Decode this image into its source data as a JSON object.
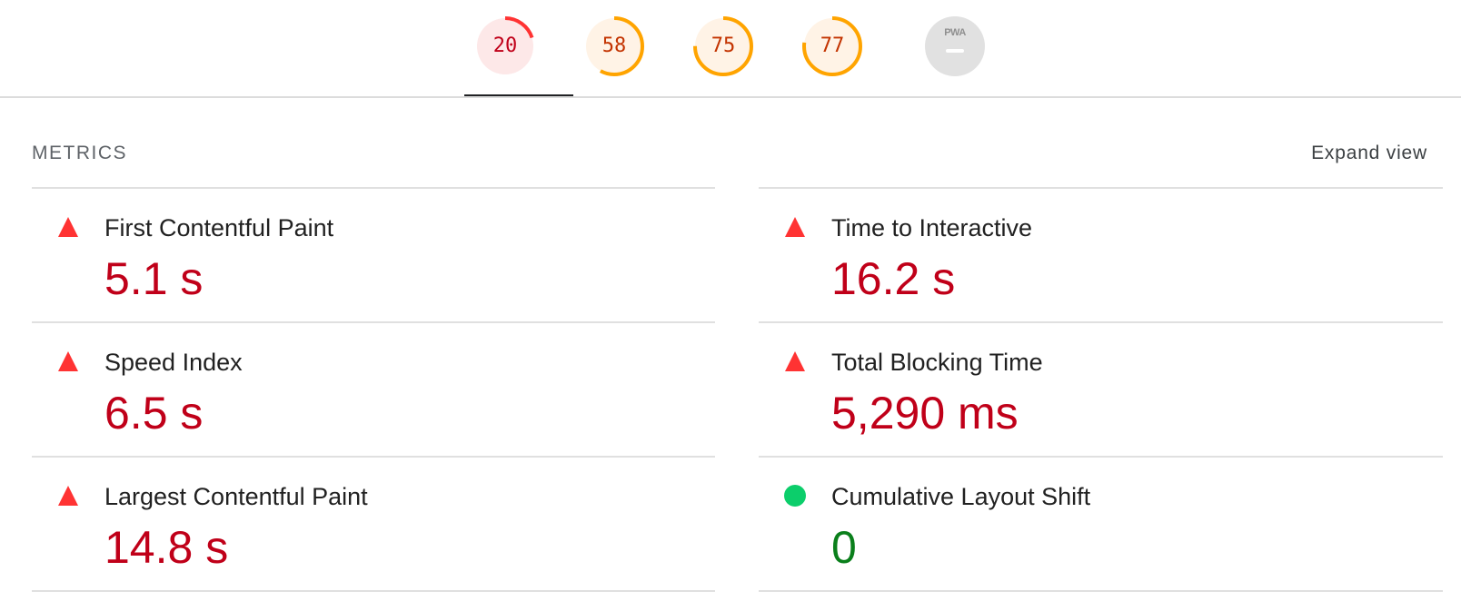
{
  "categories": [
    {
      "score": "20",
      "status": "fail",
      "progress": 0.2,
      "ring_color": "#ff3333",
      "bg_color": "#fde8e8",
      "text_color": "#c00019",
      "icon": "score-gauge"
    },
    {
      "score": "58",
      "status": "average",
      "progress": 0.58,
      "ring_color": "#ffa400",
      "bg_color": "#fff3e6",
      "text_color": "#c33300",
      "icon": "score-gauge"
    },
    {
      "score": "75",
      "status": "average",
      "progress": 0.75,
      "ring_color": "#ffa400",
      "bg_color": "#fff3e6",
      "text_color": "#c33300",
      "icon": "score-gauge"
    },
    {
      "score": "77",
      "status": "average",
      "progress": 0.77,
      "ring_color": "#ffa400",
      "bg_color": "#fff3e6",
      "text_color": "#c33300",
      "icon": "score-gauge"
    },
    {
      "label": "PWA",
      "status": "not-applicable",
      "bg_color": "#e1e1e1",
      "icon": "pwa-badge"
    }
  ],
  "metrics_section": {
    "title": "METRICS",
    "expand_label": "Expand view"
  },
  "metrics_left": [
    {
      "label": "First Contentful Paint",
      "value": "5.1 s",
      "status": "fail",
      "icon": "red-triangle"
    },
    {
      "label": "Speed Index",
      "value": "6.5 s",
      "status": "fail",
      "icon": "red-triangle"
    },
    {
      "label": "Largest Contentful Paint",
      "value": "14.8 s",
      "status": "fail",
      "icon": "red-triangle"
    }
  ],
  "metrics_right": [
    {
      "label": "Time to Interactive",
      "value": "16.2 s",
      "status": "fail",
      "icon": "red-triangle"
    },
    {
      "label": "Total Blocking Time",
      "value": "5,290 ms",
      "status": "fail",
      "icon": "red-triangle"
    },
    {
      "label": "Cumulative Layout Shift",
      "value": "0",
      "status": "pass",
      "icon": "green-circle"
    }
  ],
  "colors": {
    "fail": "#ff3333",
    "fail_text": "#c00019",
    "pass": "#0cce6b",
    "pass_text": "#0a7f1b",
    "average": "#ffa400"
  }
}
